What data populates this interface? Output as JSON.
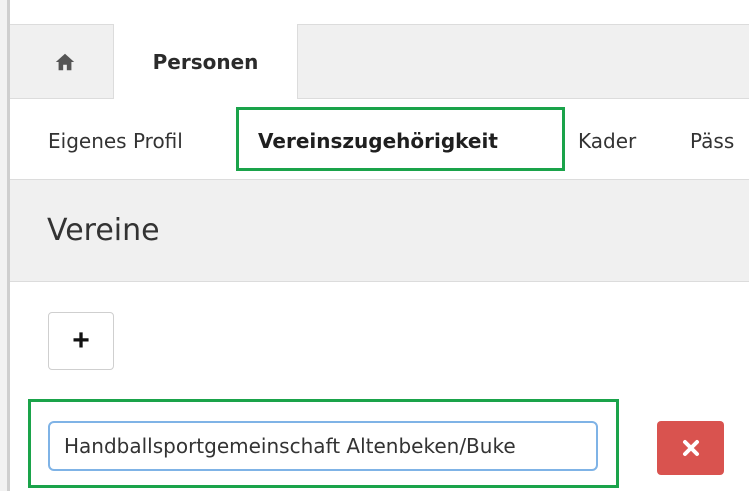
{
  "tabs": {
    "home_icon": "home-icon",
    "active_tab_label": "Personen"
  },
  "subnav": {
    "items": [
      {
        "label": "Eigenes Profil"
      },
      {
        "label": "Vereinszugehörigkeit",
        "active": true
      },
      {
        "label": "Kader"
      },
      {
        "label": "Päss"
      }
    ]
  },
  "section": {
    "title": "Vereine"
  },
  "add_button": {
    "label": "+"
  },
  "club_field": {
    "value": "Handballsportgemeinschaft Altenbeken/Buke"
  },
  "delete_button": {
    "icon": "close-icon"
  },
  "colors": {
    "highlight": "#1aa34a",
    "danger": "#d9534f",
    "input_focus": "#7fb3e6",
    "panel_bg": "#f0f0f0"
  }
}
